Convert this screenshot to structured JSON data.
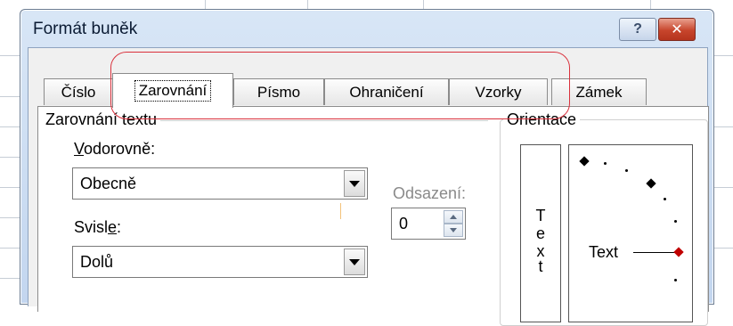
{
  "dialog": {
    "title": "Formát buněk",
    "help_button": "?",
    "close_button": "✕"
  },
  "tabs": [
    {
      "label": "Číslo",
      "active": false
    },
    {
      "label": "Zarovnání",
      "active": true
    },
    {
      "label": "Písmo",
      "active": false
    },
    {
      "label": "Ohraničení",
      "active": false
    },
    {
      "label": "Vzorky",
      "active": false
    },
    {
      "label": "Zámek",
      "active": false
    }
  ],
  "text_alignment": {
    "group_label": "Zarovnání textu",
    "horizontal": {
      "label_underlined": "V",
      "label_rest": "odorovně:",
      "value": "Obecně"
    },
    "vertical": {
      "label_start": "Svisl",
      "label_underlined": "e",
      "label_end": ":",
      "value": "Dolů"
    },
    "indent": {
      "label": "Odsazení:",
      "value": "0"
    }
  },
  "orientation": {
    "group_label": "Orientace",
    "vertical_text_letters": [
      "T",
      "e",
      "x",
      "t"
    ],
    "dial_text": "Text"
  },
  "colors": {
    "highlight_ring": "#d9313c",
    "active_diamond": "#c00000"
  }
}
